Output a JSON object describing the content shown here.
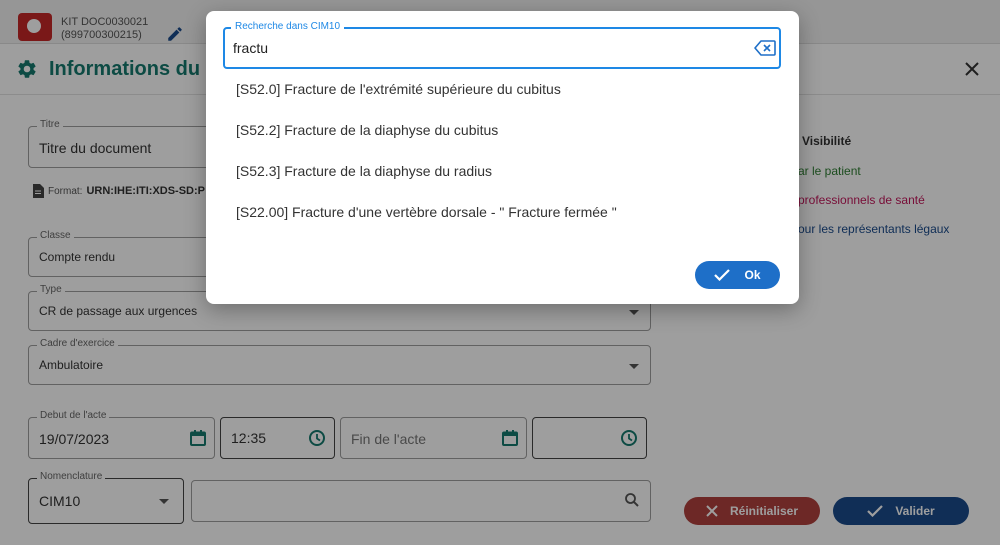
{
  "topbar": {
    "line1": "KIT DOC0030021",
    "line2": "(899700300215)"
  },
  "page": {
    "title": "Informations du d"
  },
  "form": {
    "titre": {
      "label": "Titre",
      "value": "Titre du document"
    },
    "format": {
      "label": "Format:",
      "value": "URN:IHE:ITI:XDS-SD:P"
    },
    "classe": {
      "label": "Classe",
      "value": "Compte rendu"
    },
    "type": {
      "label": "Type",
      "value": "CR de passage aux urgences"
    },
    "cadre": {
      "label": "Cadre d'exercice",
      "value": "Ambulatoire"
    },
    "debut": {
      "label": "Debut de l'acte",
      "date": "19/07/2023",
      "time": "12:35"
    },
    "fin": {
      "placeholder": "Fin de l'acte"
    },
    "nomenclature": {
      "label": "Nomenclature",
      "value": "CIM10"
    }
  },
  "visibility": {
    "title": "Visibilité",
    "patient": "ar le patient",
    "pros": "professionnels de santé",
    "legaux": "our les représentants légaux"
  },
  "buttons": {
    "reset": "Réinitialiser",
    "validate": "Valider"
  },
  "dialog": {
    "search_label": "Recherche dans CIM10",
    "search_value": "fractu",
    "results": [
      "[S52.0] Fracture de l'extrémité supérieure du cubitus",
      "[S52.2] Fracture de la diaphyse du cubitus",
      "[S52.3] Fracture de la diaphyse du radius",
      "[S22.00] Fracture d'une vertèbre dorsale - \" Fracture fermée \""
    ],
    "ok_label": "Ok"
  },
  "colors": {
    "accent": "#1e88e5",
    "title_green": "#157a6e",
    "reset_red": "#b0413e",
    "validate_blue": "#1a4b8c"
  }
}
